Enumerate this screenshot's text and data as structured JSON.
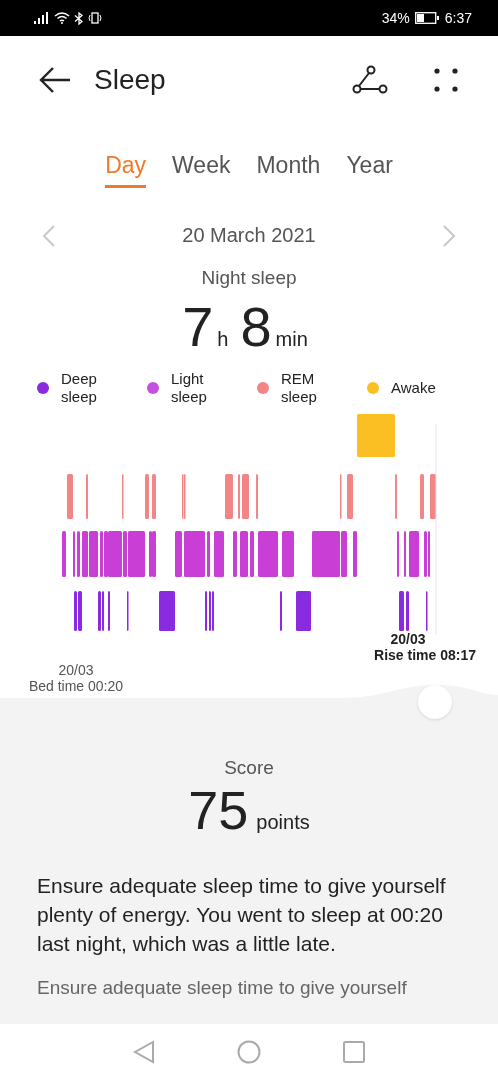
{
  "status_bar": {
    "battery": "34%",
    "time": "6:37"
  },
  "header": {
    "title": "Sleep"
  },
  "tabs": [
    {
      "label": "Day",
      "selected": true
    },
    {
      "label": "Week",
      "selected": false
    },
    {
      "label": "Month",
      "selected": false
    },
    {
      "label": "Year",
      "selected": false
    }
  ],
  "date": "20 March 2021",
  "summary": {
    "label": "Night sleep",
    "hours": "7",
    "hours_unit": "h",
    "minutes": "8",
    "minutes_unit": "min"
  },
  "legend": [
    {
      "label": "Deep\nsleep",
      "color": "#8a2be2"
    },
    {
      "label": "Light\nsleep",
      "color": "#c74fe0"
    },
    {
      "label": "REM\nsleep",
      "color": "#f28585"
    },
    {
      "label": "Awake",
      "color": "#fbbf24"
    }
  ],
  "rise": {
    "date": "20/03",
    "label": "Rise time 08:17"
  },
  "bed": {
    "date": "20/03",
    "label": "Bed time 00:20"
  },
  "score": {
    "label": "Score",
    "value": "75",
    "unit": "points"
  },
  "advice": [
    "Ensure adequate sleep time to give yourself plenty of energy. You went to sleep at 00:20 last night, which was a little late.",
    "Ensure adequate sleep time to give yourself"
  ]
}
